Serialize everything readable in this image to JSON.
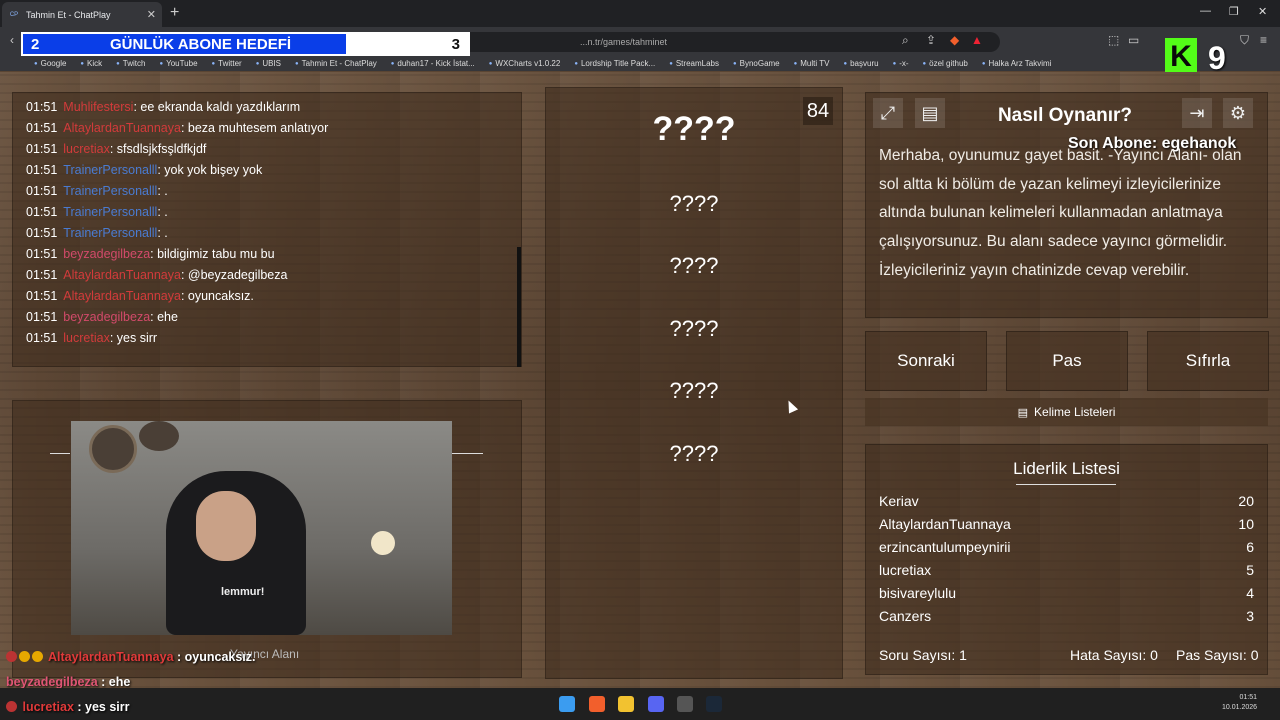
{
  "browser": {
    "tab_title": "Tahmin Et - ChatPlay",
    "tab_favicon": "CP",
    "url": "...n.tr/games/tahminet",
    "bookmarks": [
      "Google",
      "Kick",
      "Twitch",
      "YouTube",
      "Twitter",
      "UBIS",
      "Tahmin Et - ChatPlay",
      "duhan17 - Kick İstat...",
      "WXCharts v1.0.22",
      "Lordship Title Pack...",
      "StreamLabs",
      "BynoGame",
      "Multi TV",
      "başvuru",
      "-x-",
      "özel github",
      "Halka Arz Takvimi"
    ]
  },
  "overlay": {
    "goal_current": "2",
    "goal_label": "GÜNLÜK ABONE HEDEFİ",
    "goal_target": "3",
    "kick_logo": "K",
    "kick_number": "9",
    "last_sub": "Son Abone: egehanok"
  },
  "chat": [
    {
      "time": "01:51",
      "user": "Muhlifestersi",
      "color": "red",
      "msg": ": ee ekranda kaldı yazdıklarım"
    },
    {
      "time": "01:51",
      "user": "AltaylardanTuannaya",
      "color": "red",
      "msg": ": beza muhtesem anlatıyor"
    },
    {
      "time": "01:51",
      "user": "lucretiax",
      "color": "red",
      "msg": ": sfsdlsjkfsşldfkjdf"
    },
    {
      "time": "01:51",
      "user": "TrainerPersonalll",
      "color": "blue",
      "msg": ": yok yok bişey yok"
    },
    {
      "time": "01:51",
      "user": "TrainerPersonalll",
      "color": "blue",
      "msg": ": ."
    },
    {
      "time": "01:51",
      "user": "TrainerPersonalll",
      "color": "blue",
      "msg": ": ."
    },
    {
      "time": "01:51",
      "user": "TrainerPersonalll",
      "color": "blue",
      "msg": ": ."
    },
    {
      "time": "01:51",
      "user": "beyzadegilbeza",
      "color": "pink",
      "msg": ": bildigimiz tabu mu bu"
    },
    {
      "time": "01:51",
      "user": "AltaylardanTuannaya",
      "color": "red",
      "msg": ": @beyzadegilbeza"
    },
    {
      "time": "01:51",
      "user": "AltaylardanTuannaya",
      "color": "red",
      "msg": ": oyuncaksız."
    },
    {
      "time": "01:51",
      "user": "beyzadegilbeza",
      "color": "pink",
      "msg": ": ehe"
    },
    {
      "time": "01:51",
      "user": "lucretiax",
      "color": "red",
      "msg": ": yes sirr"
    }
  ],
  "camera": {
    "shirt_text": "lemmur!",
    "label": "Yayıncı Alanı"
  },
  "game": {
    "timer": "84",
    "main_word": "????",
    "taboo_words": [
      "????",
      "????",
      "????",
      "????",
      "????"
    ]
  },
  "rules": {
    "title": "Nasıl Oynanır?",
    "text": "Merhaba, oyunumuz gayet basit. -Yayıncı Alanı- olan sol altta ki bölüm de yazan kelimeyi izleyicilerinize altında bulunan kelimeleri kullanmadan anlatmaya çalışıyorsunuz. Bu alanı sadece yayıncı görmelidir. İzleyicileriniz yayın chatinizde cevap verebilir."
  },
  "actions": {
    "next": "Sonraki",
    "pass": "Pas",
    "reset": "Sıfırla",
    "word_lists": "Kelime Listeleri"
  },
  "leaderboard": {
    "title": "Liderlik Listesi",
    "rows": [
      {
        "name": "Keriav",
        "score": "20"
      },
      {
        "name": "AltaylardanTuannaya",
        "score": "10"
      },
      {
        "name": "erzincantulumpeynirii",
        "score": "6"
      },
      {
        "name": "lucretiax",
        "score": "5"
      },
      {
        "name": "bisivareylulu",
        "score": "4"
      },
      {
        "name": "Canzers",
        "score": "3"
      }
    ],
    "question_count": "Soru Sayısı: 1",
    "error_count": "Hata Sayısı: 0",
    "pass_count": "Pas Sayısı: 0"
  },
  "stream_chat_overlay": [
    {
      "user": "AltaylardanTuannaya",
      "color": "red",
      "msg": " : oyuncaksız."
    },
    {
      "user": "beyzadegilbeza",
      "color": "white",
      "msg": " : ehe"
    },
    {
      "user": "lucretiax",
      "color": "pink",
      "msg": " : yes sirr"
    }
  ],
  "taskbar": {
    "time": "01:51",
    "date": "10.01.2026"
  },
  "colors": {
    "goal_blue": "#0a3ee8",
    "kick_green": "#53fc18",
    "chat_red": "#d23b3b",
    "chat_blue": "#4a7bd1"
  }
}
